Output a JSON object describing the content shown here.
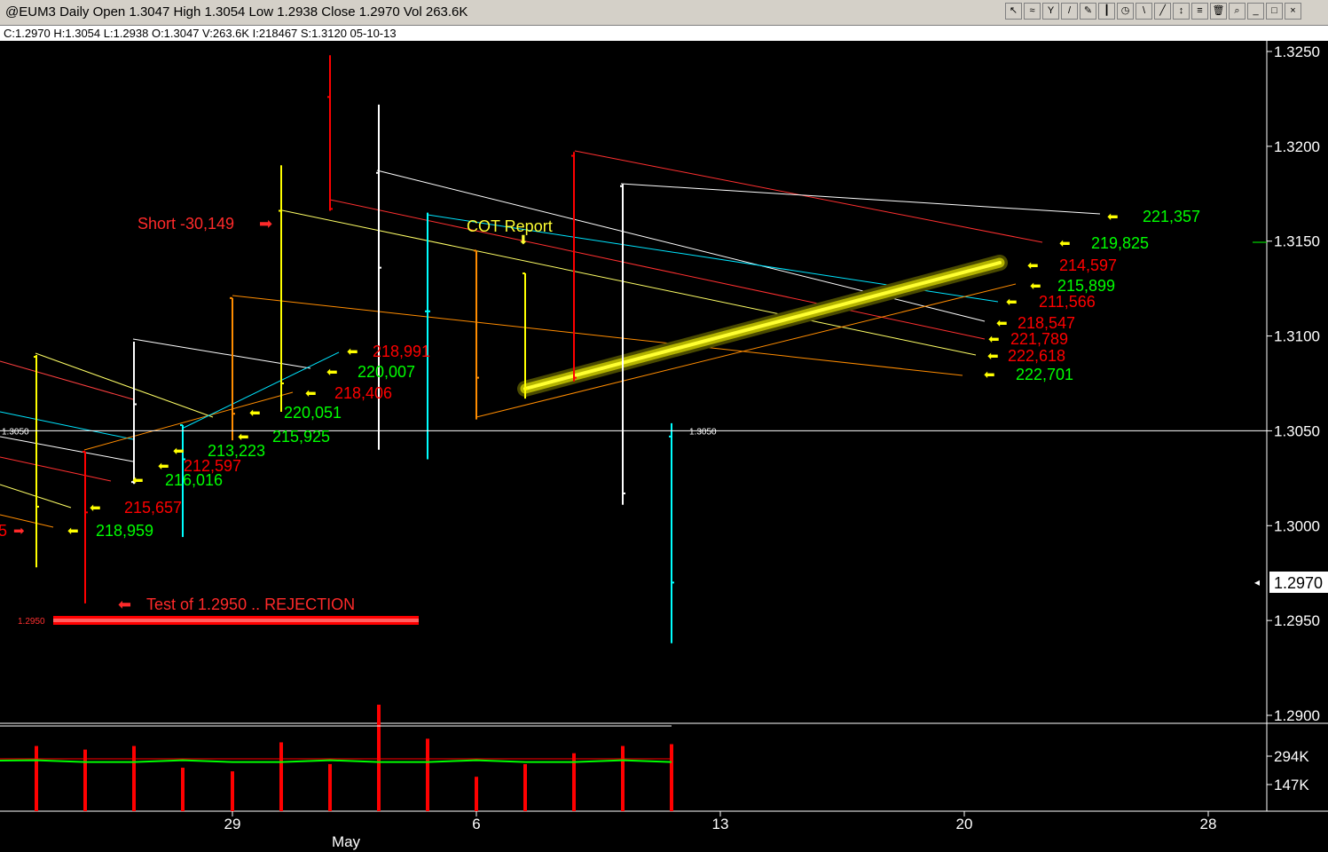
{
  "window": {
    "title": "@EUM3 Daily Open 1.3047 High 1.3054 Low 1.2938 Close 1.2970 Vol 263.6K",
    "info": "C:1.2970  H:1.3054  L:1.2938  O:1.3047  V:263.6K  I:218467  S:1.3120  05-10-13"
  },
  "colors": {
    "background": "#000000",
    "up": "#ffffff",
    "down": "#ff0000",
    "green_label": "#00ff00",
    "arrow": "#ffff00"
  },
  "chart_data": {
    "type": "candlestick",
    "symbol": "@EUM3",
    "period": "Daily",
    "ylim": [
      1.2885,
      1.3255
    ],
    "y_ticks": [
      "1.3250",
      "1.3200",
      "1.3150",
      "1.3100",
      "1.3050",
      "1.3000",
      "1.2950",
      "1.2900"
    ],
    "current_price": "1.2970",
    "x_ticks": [
      "29",
      "6",
      "13",
      "20",
      "28"
    ],
    "x_month": "May",
    "volume_ticks": [
      "294K",
      "147K"
    ],
    "bars": [
      {
        "date": "Apr-24",
        "open": 1.3089,
        "high": 1.309,
        "low": 1.2978,
        "close": 1.301,
        "color": "#ffff00"
      },
      {
        "date": "Apr-25",
        "open": 1.3039,
        "high": 1.3039,
        "low": 1.2959,
        "close": 1.3007,
        "color": "#ff0000"
      },
      {
        "date": "Apr-26",
        "open": 1.3023,
        "high": 1.3097,
        "low": 1.3022,
        "close": 1.3064,
        "color": "#ffffff"
      },
      {
        "date": "Apr-29",
        "open": 1.3053,
        "high": 1.3053,
        "low": 1.2994,
        "close": 1.3035,
        "color": "#00ffff"
      },
      {
        "date": "Apr-30",
        "open": 1.312,
        "high": 1.312,
        "low": 1.3045,
        "close": 1.3059,
        "color": "#ff8c00"
      },
      {
        "date": "May-01",
        "open": 1.3166,
        "high": 1.319,
        "low": 1.306,
        "close": 1.3075,
        "color": "#ffff00"
      },
      {
        "date": "May-02",
        "open": 1.3226,
        "high": 1.3248,
        "low": 1.3166,
        "close": 1.3167,
        "color": "#ff0000"
      },
      {
        "date": "May-03",
        "open": 1.3186,
        "high": 1.3222,
        "low": 1.304,
        "close": 1.3136,
        "color": "#ffffff"
      },
      {
        "date": "May-06",
        "open": 1.3113,
        "high": 1.3165,
        "low": 1.3035,
        "close": 1.3113,
        "color": "#00ffff"
      },
      {
        "date": "May-07",
        "open": 1.3145,
        "high": 1.3145,
        "low": 1.3056,
        "close": 1.3078,
        "color": "#ff8c00"
      },
      {
        "date": "May-08",
        "open": 1.3133,
        "high": 1.3133,
        "low": 1.3067,
        "close": 1.3072,
        "color": "#ffff00"
      },
      {
        "date": "May-09",
        "open": 1.3195,
        "high": 1.3197,
        "low": 1.3076,
        "close": 1.3078,
        "color": "#ff0000"
      },
      {
        "date": "May-10",
        "open": 1.3179,
        "high": 1.318,
        "low": 1.3011,
        "close": 1.3017,
        "color": "#ffffff"
      },
      {
        "date": "May-13",
        "open": 1.3047,
        "high": 1.3054,
        "low": 1.2938,
        "close": 1.297,
        "color": "#00ffff"
      }
    ],
    "volume_values": [
      180,
      170,
      180,
      120,
      110,
      190,
      130,
      294,
      200,
      95,
      130,
      160,
      180,
      185
    ],
    "volume_ma": [
      0.38,
      0.38,
      0.38,
      0.38,
      0.38,
      0.38,
      0.38,
      0.38,
      0.38,
      0.38,
      0.38,
      0.38,
      0.38,
      0.38
    ],
    "horizontal_lines": [
      {
        "value": 1.305,
        "label": "1.3050"
      }
    ],
    "support_band": {
      "value": 1.295,
      "label": "1.2950"
    },
    "annotations": {
      "short": "Short  -30,149",
      "cot": "COT Report",
      "rejection": "Test of 1.2950   ..  REJECTION"
    },
    "cot_labels": [
      {
        "text": "221,357",
        "color": "#00ff00"
      },
      {
        "text": "219,825",
        "color": "#00ff00"
      },
      {
        "text": "214,597",
        "color": "#ff0000"
      },
      {
        "text": "215,899",
        "color": "#00ff00"
      },
      {
        "text": "211,566",
        "color": "#ff0000"
      },
      {
        "text": "218,547",
        "color": "#ff0000"
      },
      {
        "text": "221,789",
        "color": "#ff0000"
      },
      {
        "text": "222,618",
        "color": "#ff0000"
      },
      {
        "text": "222,701",
        "color": "#00ff00"
      },
      {
        "text": "218,991",
        "color": "#ff0000"
      },
      {
        "text": "220,007",
        "color": "#00ff00"
      },
      {
        "text": "218,406",
        "color": "#ff0000"
      },
      {
        "text": "220,051",
        "color": "#00ff00"
      },
      {
        "text": "215,925",
        "color": "#00ff00"
      },
      {
        "text": "213,223",
        "color": "#00ff00"
      },
      {
        "text": "212,597",
        "color": "#ff0000"
      },
      {
        "text": "216,016",
        "color": "#00ff00"
      },
      {
        "text": "215,657",
        "color": "#ff0000"
      },
      {
        "text": "218,959",
        "color": "#00ff00"
      },
      {
        "text": "5",
        "color": "#ff0000"
      }
    ]
  }
}
